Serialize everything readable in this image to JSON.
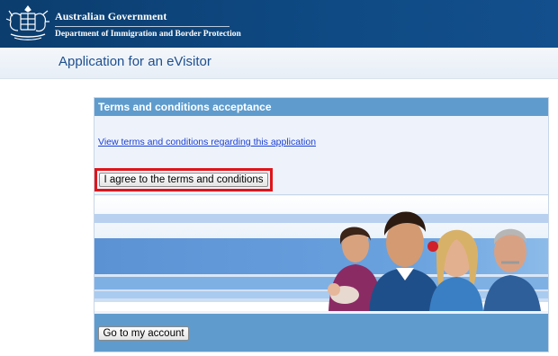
{
  "header": {
    "line1": "Australian Government",
    "line2": "Department of Immigration and Border Protection",
    "crest_icon": "coat-of-arms-icon"
  },
  "app_title": "Application for an eVisitor",
  "panel": {
    "heading": "Terms and conditions acceptance",
    "terms_link": "View terms and conditions regarding this application",
    "agree_button": "I agree to the terms and conditions",
    "account_button": "Go to my account"
  },
  "colors": {
    "header_bg": "#0f4a84",
    "panel_head_bg": "#5f9ccd",
    "highlight": "#e0151b",
    "link": "#1a3fd1"
  }
}
